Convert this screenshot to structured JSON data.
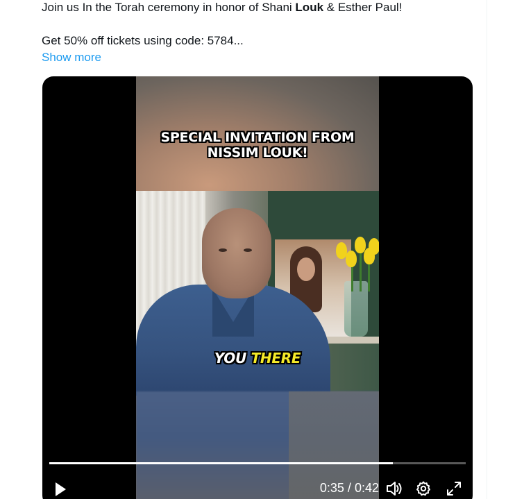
{
  "tweet": {
    "line1_pre": "Join us In the Torah ceremony in honor of Shani ",
    "line1_bold": "Louk",
    "line1_post": " & Esther Paul!",
    "line2": "Get 50% off tickets using code: 5784...",
    "show_more": "Show more"
  },
  "video": {
    "caption_top": "SPECIAL INVITATION FROM NISSIM LOUK!",
    "caption_sub_word1": "YOU",
    "caption_sub_word2": "THERE",
    "current_time": "0:35",
    "time_separator": "/",
    "duration": "0:42",
    "progress": 0.825,
    "controls": [
      "play-icon",
      "volume-icon",
      "settings-icon",
      "fullscreen-icon"
    ]
  },
  "colors": {
    "link": "#1d9bf0",
    "text": "#0f1419",
    "caption_highlight": "#f5ea28"
  }
}
